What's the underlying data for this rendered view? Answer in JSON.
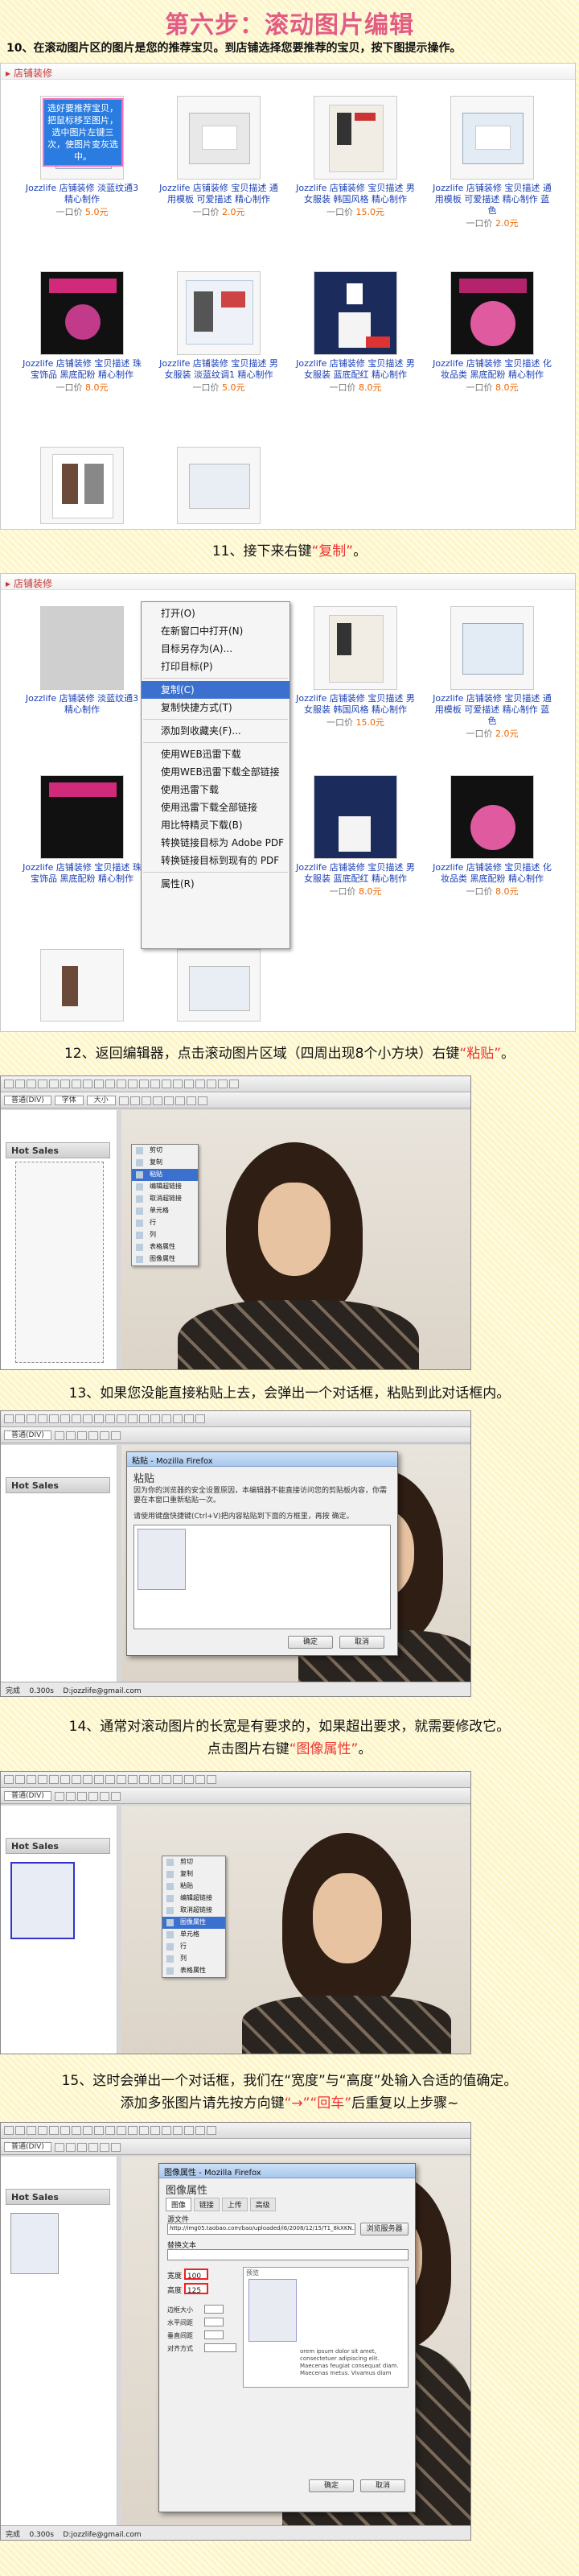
{
  "title": "第六步：滚动图片编辑",
  "step10": "10、在滚动图片区的图片是您的推荐宝贝。到店铺选择您要推荐的宝贝，按下图提示操作。",
  "shop_bar": "店铺装修",
  "promo_text": "选好要推荐宝贝，把鼠标移至图片，选中图片左键三次，使图片变灰选中。",
  "items": [
    {
      "name": "Jozzlife 店铺装修 淡蓝纹通3 精心制作",
      "price": "一口价",
      "price_val": "5.0元"
    },
    {
      "name": "Jozzlife 店铺装修 宝贝描述 通用模板 可爱描述 精心制作",
      "price": "一口价",
      "price_val": "2.0元"
    },
    {
      "name": "Jozzlife 店铺装修 宝贝描述 男女服装 韩国风格 精心制作",
      "price": "一口价",
      "price_val": "15.0元"
    },
    {
      "name": "Jozzlife 店铺装修 宝贝描述 通用模板 可爱描述 精心制作 蓝色",
      "price": "一口价",
      "price_val": "2.0元"
    },
    {
      "name": "Jozzlife 店铺装修 宝贝描述 珠宝饰品 黑底配粉 精心制作",
      "price": "一口价",
      "price_val": "8.0元"
    },
    {
      "name": "Jozzlife 店铺装修 宝贝描述 男女服装 淡蓝纹调1 精心制作",
      "price": "一口价",
      "price_val": "5.0元"
    },
    {
      "name": "Jozzlife 店铺装修 宝贝描述 男女服装 蓝底配红 精心制作",
      "price": "一口价",
      "price_val": "8.0元"
    },
    {
      "name": "Jozzlife 店铺装修 宝贝描述 化妆品类 黑底配粉 精心制作",
      "price": "一口价",
      "price_val": "8.0元"
    }
  ],
  "step11_pre": "11、接下来右键",
  "step11_hl": "“复制”",
  "step11_post": "。",
  "context_menu": [
    "打开(O)",
    "在新窗口中打开(N)",
    "目标另存为(A)...",
    "打印目标(P)",
    "复制(C)",
    "复制快捷方式(T)",
    "添加到收藏夹(F)...",
    "使用WEB迅雷下载",
    "使用WEB迅雷下载全部链接",
    "使用迅雷下载",
    "使用迅雷下载全部链接",
    "用比特精灵下载(B)",
    "转换链接目标为 Adobe PDF",
    "转换链接目标到现有的 PDF",
    "属性(R)"
  ],
  "step12_pre": "12、返回编辑器，点击滚动图片区域（四周出现8个小方块）右键",
  "step12_hl": "“粘贴”",
  "step12_post": "。",
  "hot_sales": "Hot Sales",
  "mini_menu": [
    "剪切",
    "复制",
    "粘贴",
    "编辑超链接",
    "取消超链接",
    "单元格",
    "行",
    "列",
    "表格属性",
    "图像属性"
  ],
  "step13": "13、如果您没能直接粘贴上去，会弹出一个对话框，粘贴到此对话框内。",
  "paste_dialog": {
    "title": "粘贴 - Mozilla Firefox",
    "heading": "粘贴",
    "desc": "因为你的浏览器的安全设置原因，本编辑器不能直接访问您的剪贴板内容，你需要在本窗口重新粘贴一次。",
    "hint": "请使用键盘快捷键(Ctrl+V)把内容粘贴到下面的方框里，再按 确定。",
    "ok": "确定",
    "cancel": "取消"
  },
  "status": {
    "done": "完成",
    "time": "0.300s",
    "email": "D:jozzlife@gmail.com"
  },
  "step14_a": "14、通常对滚动图片的长宽是有要求的，如果超出要求，就需要修改它。",
  "step14_b_pre": "点击图片右键",
  "step14_b_hl": "“图像属性”",
  "step14_b_post": "。",
  "step15_a": "15、这时会弹出一个对话框，我们在“宽度”与“高度”处输入合适的值确定。",
  "step15_b_pre": "添加多张图片请先按方向键",
  "step15_b_hl1": "“→”",
  "step15_b_hl2": "“回车”",
  "step15_b_post": "后重复以上步骤~",
  "img_dialog": {
    "title": "图像属性 - Mozilla Firefox",
    "heading": "图像属性",
    "tabs": [
      "图像",
      "链接",
      "上传",
      "高级"
    ],
    "url_label": "源文件",
    "url": "http://img05.taobao.com/bao/uploaded/i6/2008/12/15/T1_8kXKN...",
    "browse": "浏览服务器",
    "alt_label": "替换文本",
    "width_label": "宽度",
    "width": "100",
    "height_label": "高度",
    "height": "125",
    "border_label": "边框大小",
    "hspace_label": "水平间距",
    "vspace_label": "垂直间距",
    "align_label": "对齐方式",
    "preview": "预览",
    "lorem": "orem ipsum dolor sit amet, consectetuer adipiscing elit. Maecenas feugiat consequat diam. Maecenas metus. Vivamus diam"
  },
  "editor": {
    "font": "字体",
    "size": "大小",
    "format": "普通(DIV)"
  }
}
